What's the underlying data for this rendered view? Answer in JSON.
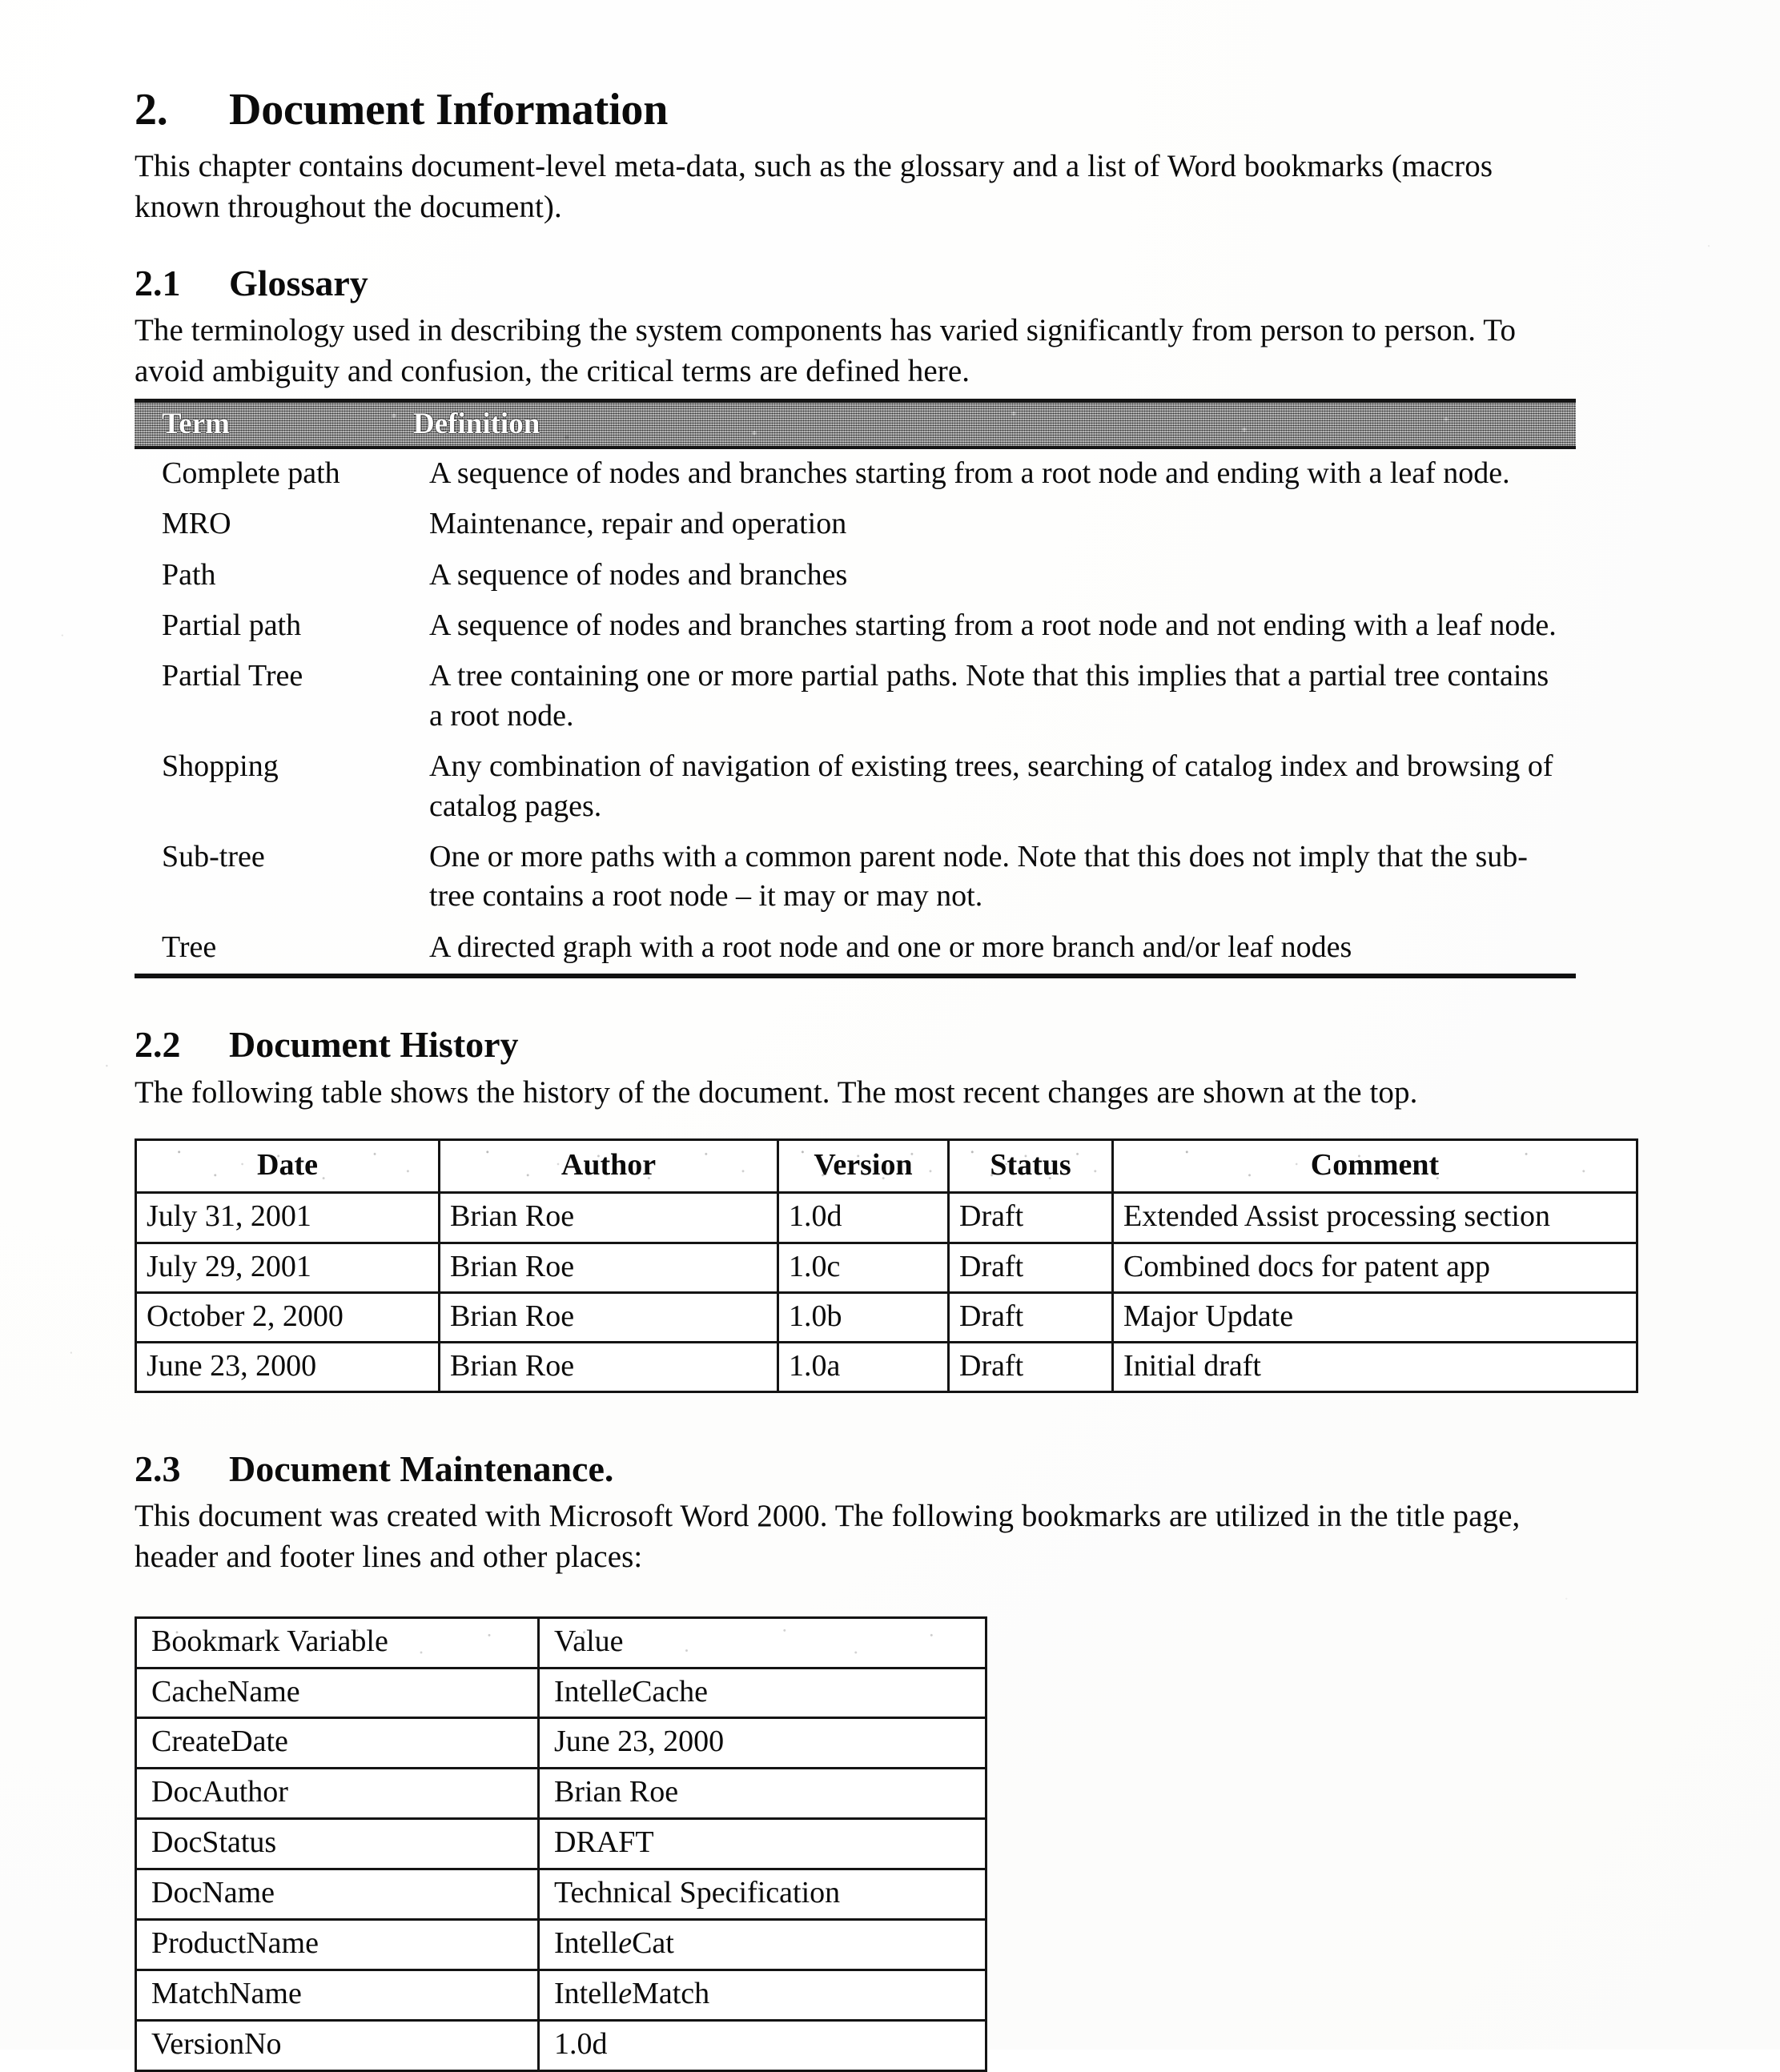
{
  "section": {
    "number": "2.",
    "title": "Document Information",
    "intro": "This chapter contains document-level meta-data, such as the glossary and a list of Word bookmarks (macros known throughout the document)."
  },
  "glossary": {
    "number": "2.1",
    "title": "Glossary",
    "intro": "The terminology used in describing the system components has varied significantly from person to person.  To avoid ambiguity and confusion, the critical terms are defined here.",
    "columns": [
      "Term",
      "Definition"
    ],
    "rows": [
      {
        "term": "Complete path",
        "definition": "A sequence of nodes and branches starting from a root node and ending with a leaf node."
      },
      {
        "term": "MRO",
        "definition": "Maintenance, repair and operation"
      },
      {
        "term": "Path",
        "definition": "A sequence of nodes and branches"
      },
      {
        "term": "Partial path",
        "definition": "A sequence of nodes and branches starting from a root node and not ending with a leaf node."
      },
      {
        "term": "Partial Tree",
        "definition": "A tree containing one or more partial paths.  Note that this implies that a partial tree contains a root node."
      },
      {
        "term": "Shopping",
        "definition": "Any combination of navigation of existing trees, searching of catalog index and browsing of catalog pages."
      },
      {
        "term": "Sub-tree",
        "definition": "One or more paths with a common parent node.  Note that this does not imply that the sub-tree contains a root node – it may or may not."
      },
      {
        "term": "Tree",
        "definition": "A directed graph with a root node and one or more branch and/or leaf nodes"
      }
    ]
  },
  "history": {
    "number": "2.2",
    "title": "Document History",
    "intro": "The following table shows the history of the document.  The most recent changes are shown at the top.",
    "columns": [
      "Date",
      "Author",
      "Version",
      "Status",
      "Comment"
    ],
    "rows": [
      {
        "date": "July 31, 2001",
        "author": "Brian Roe",
        "version": "1.0d",
        "status": "Draft",
        "comment": "Extended Assist processing section"
      },
      {
        "date": "July 29, 2001",
        "author": "Brian Roe",
        "version": "1.0c",
        "status": "Draft",
        "comment": "Combined docs for patent app"
      },
      {
        "date": "October 2, 2000",
        "author": "Brian Roe",
        "version": "1.0b",
        "status": "Draft",
        "comment": "Major Update"
      },
      {
        "date": "June 23, 2000",
        "author": "Brian Roe",
        "version": "1.0a",
        "status": "Draft",
        "comment": "Initial draft"
      }
    ]
  },
  "maintenance": {
    "number": "2.3",
    "title": "Document Maintenance.",
    "intro": "This document was created with Microsoft Word 2000. The following bookmarks are utilized in the title page, header and footer lines and other places:",
    "columns": [
      "Bookmark Variable",
      "Value"
    ],
    "rows": [
      {
        "variable": "CacheName",
        "value_pre": "Intell",
        "value_it": "e",
        "value_post": "Cache"
      },
      {
        "variable": "CreateDate",
        "value_pre": "June 23, 2000",
        "value_it": "",
        "value_post": ""
      },
      {
        "variable": "DocAuthor",
        "value_pre": "Brian Roe",
        "value_it": "",
        "value_post": ""
      },
      {
        "variable": "DocStatus",
        "value_pre": "DRAFT",
        "value_it": "",
        "value_post": ""
      },
      {
        "variable": "DocName",
        "value_pre": "Technical Specification",
        "value_it": "",
        "value_post": ""
      },
      {
        "variable": "ProductName",
        "value_pre": "Intell",
        "value_it": "e",
        "value_post": "Cat"
      },
      {
        "variable": "MatchName",
        "value_pre": "Intell",
        "value_it": "e",
        "value_post": "Match"
      },
      {
        "variable": "VersionNo",
        "value_pre": "1.0d",
        "value_it": "",
        "value_post": ""
      }
    ]
  }
}
